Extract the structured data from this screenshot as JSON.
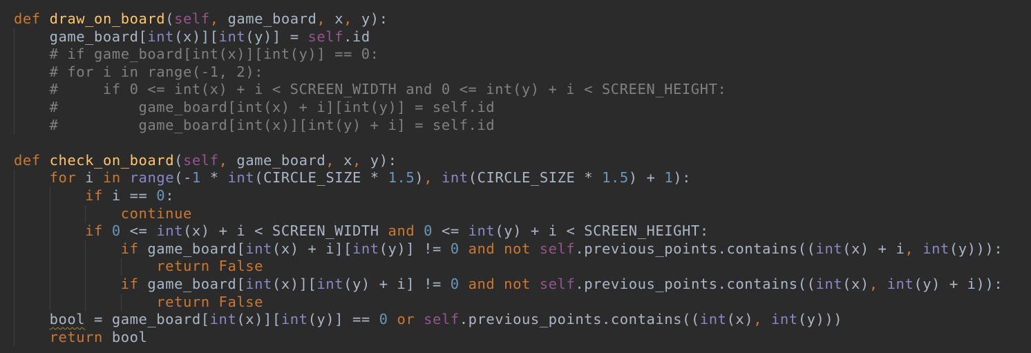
{
  "editor": {
    "lines": [
      [
        {
          "t": "def",
          "c": "kw"
        },
        {
          "t": " ",
          "c": "plain"
        },
        {
          "t": "draw_on_board",
          "c": "fn"
        },
        {
          "t": "(",
          "c": "plain"
        },
        {
          "t": "self",
          "c": "self"
        },
        {
          "t": ",",
          "c": "kw"
        },
        {
          "t": " game_board",
          "c": "plain"
        },
        {
          "t": ",",
          "c": "kw"
        },
        {
          "t": " x",
          "c": "plain"
        },
        {
          "t": ",",
          "c": "kw"
        },
        {
          "t": " y):",
          "c": "plain"
        }
      ],
      [
        {
          "t": "    game_board[",
          "c": "plain"
        },
        {
          "t": "int",
          "c": "builtin"
        },
        {
          "t": "(x)][",
          "c": "plain"
        },
        {
          "t": "int",
          "c": "builtin"
        },
        {
          "t": "(y)] = ",
          "c": "plain"
        },
        {
          "t": "self",
          "c": "self"
        },
        {
          "t": ".id",
          "c": "plain"
        }
      ],
      [
        {
          "t": "    # if game_board[int(x)][int(y)] == 0:",
          "c": "comment"
        }
      ],
      [
        {
          "t": "    # for i in range(-1, 2):",
          "c": "comment"
        }
      ],
      [
        {
          "t": "    #     if 0 <= int(x) + i < SCREEN_WIDTH and 0 <= int(y) + i < SCREEN_HEIGHT:",
          "c": "comment"
        }
      ],
      [
        {
          "t": "    #         game_board[int(x) + i][int(y)] = self.id",
          "c": "comment"
        }
      ],
      [
        {
          "t": "    #         game_board[int(x)][int(y) + i] = self.id",
          "c": "comment"
        }
      ],
      [],
      [
        {
          "t": "def",
          "c": "kw"
        },
        {
          "t": " ",
          "c": "plain"
        },
        {
          "t": "check_on_board",
          "c": "fn"
        },
        {
          "t": "(",
          "c": "plain"
        },
        {
          "t": "self",
          "c": "self"
        },
        {
          "t": ",",
          "c": "kw"
        },
        {
          "t": " game_board",
          "c": "plain"
        },
        {
          "t": ",",
          "c": "kw"
        },
        {
          "t": " x",
          "c": "plain"
        },
        {
          "t": ",",
          "c": "kw"
        },
        {
          "t": " y):",
          "c": "plain"
        }
      ],
      [
        {
          "t": "    ",
          "c": "plain"
        },
        {
          "t": "for",
          "c": "kw"
        },
        {
          "t": " i ",
          "c": "plain"
        },
        {
          "t": "in",
          "c": "kw"
        },
        {
          "t": " ",
          "c": "plain"
        },
        {
          "t": "range",
          "c": "builtin"
        },
        {
          "t": "(-",
          "c": "plain"
        },
        {
          "t": "1",
          "c": "num"
        },
        {
          "t": " * ",
          "c": "plain"
        },
        {
          "t": "int",
          "c": "builtin"
        },
        {
          "t": "(CIRCLE_SIZE * ",
          "c": "plain"
        },
        {
          "t": "1.5",
          "c": "num"
        },
        {
          "t": ")",
          "c": "plain"
        },
        {
          "t": ",",
          "c": "kw"
        },
        {
          "t": " ",
          "c": "plain"
        },
        {
          "t": "int",
          "c": "builtin"
        },
        {
          "t": "(CIRCLE_SIZE * ",
          "c": "plain"
        },
        {
          "t": "1.5",
          "c": "num"
        },
        {
          "t": ") + ",
          "c": "plain"
        },
        {
          "t": "1",
          "c": "num"
        },
        {
          "t": "):",
          "c": "plain"
        }
      ],
      [
        {
          "t": "        ",
          "c": "plain"
        },
        {
          "t": "if",
          "c": "kw"
        },
        {
          "t": " i == ",
          "c": "plain"
        },
        {
          "t": "0",
          "c": "num"
        },
        {
          "t": ":",
          "c": "plain"
        }
      ],
      [
        {
          "t": "            ",
          "c": "plain"
        },
        {
          "t": "continue",
          "c": "kw"
        }
      ],
      [
        {
          "t": "        ",
          "c": "plain"
        },
        {
          "t": "if",
          "c": "kw"
        },
        {
          "t": " ",
          "c": "plain"
        },
        {
          "t": "0",
          "c": "num"
        },
        {
          "t": " <= ",
          "c": "plain"
        },
        {
          "t": "int",
          "c": "builtin"
        },
        {
          "t": "(x) + i < SCREEN_WIDTH ",
          "c": "plain"
        },
        {
          "t": "and",
          "c": "kw"
        },
        {
          "t": " ",
          "c": "plain"
        },
        {
          "t": "0",
          "c": "num"
        },
        {
          "t": " <= ",
          "c": "plain"
        },
        {
          "t": "int",
          "c": "builtin"
        },
        {
          "t": "(y) + i < SCREEN_HEIGHT:",
          "c": "plain"
        }
      ],
      [
        {
          "t": "            ",
          "c": "plain"
        },
        {
          "t": "if",
          "c": "kw"
        },
        {
          "t": " game_board[",
          "c": "plain"
        },
        {
          "t": "int",
          "c": "builtin"
        },
        {
          "t": "(x) + i][",
          "c": "plain"
        },
        {
          "t": "int",
          "c": "builtin"
        },
        {
          "t": "(y)] != ",
          "c": "plain"
        },
        {
          "t": "0",
          "c": "num"
        },
        {
          "t": " ",
          "c": "plain"
        },
        {
          "t": "and not",
          "c": "kw"
        },
        {
          "t": " ",
          "c": "plain"
        },
        {
          "t": "self",
          "c": "self"
        },
        {
          "t": ".previous_points.contains((",
          "c": "plain"
        },
        {
          "t": "int",
          "c": "builtin"
        },
        {
          "t": "(x) + i",
          "c": "plain"
        },
        {
          "t": ",",
          "c": "kw"
        },
        {
          "t": " ",
          "c": "plain"
        },
        {
          "t": "int",
          "c": "builtin"
        },
        {
          "t": "(y))):",
          "c": "plain"
        }
      ],
      [
        {
          "t": "                ",
          "c": "plain"
        },
        {
          "t": "return",
          "c": "kw"
        },
        {
          "t": " ",
          "c": "plain"
        },
        {
          "t": "False",
          "c": "kw"
        }
      ],
      [
        {
          "t": "            ",
          "c": "plain"
        },
        {
          "t": "if",
          "c": "kw"
        },
        {
          "t": " game_board[",
          "c": "plain"
        },
        {
          "t": "int",
          "c": "builtin"
        },
        {
          "t": "(x)][",
          "c": "plain"
        },
        {
          "t": "int",
          "c": "builtin"
        },
        {
          "t": "(y) + i] != ",
          "c": "plain"
        },
        {
          "t": "0",
          "c": "num"
        },
        {
          "t": " ",
          "c": "plain"
        },
        {
          "t": "and not",
          "c": "kw"
        },
        {
          "t": " ",
          "c": "plain"
        },
        {
          "t": "self",
          "c": "self"
        },
        {
          "t": ".previous_points.contains((",
          "c": "plain"
        },
        {
          "t": "int",
          "c": "builtin"
        },
        {
          "t": "(x)",
          "c": "plain"
        },
        {
          "t": ",",
          "c": "kw"
        },
        {
          "t": " ",
          "c": "plain"
        },
        {
          "t": "int",
          "c": "builtin"
        },
        {
          "t": "(y) + i)):",
          "c": "plain"
        }
      ],
      [
        {
          "t": "                ",
          "c": "plain"
        },
        {
          "t": "return",
          "c": "kw"
        },
        {
          "t": " ",
          "c": "plain"
        },
        {
          "t": "False",
          "c": "kw"
        }
      ],
      [
        {
          "t": "    ",
          "c": "plain"
        },
        {
          "t": "bool",
          "c": "warn"
        },
        {
          "t": " = game_board[",
          "c": "plain"
        },
        {
          "t": "int",
          "c": "builtin"
        },
        {
          "t": "(x)][",
          "c": "plain"
        },
        {
          "t": "int",
          "c": "builtin"
        },
        {
          "t": "(y)] == ",
          "c": "plain"
        },
        {
          "t": "0",
          "c": "num"
        },
        {
          "t": " ",
          "c": "plain"
        },
        {
          "t": "or",
          "c": "kw"
        },
        {
          "t": " ",
          "c": "plain"
        },
        {
          "t": "self",
          "c": "self"
        },
        {
          "t": ".previous_points.contains((",
          "c": "plain"
        },
        {
          "t": "int",
          "c": "builtin"
        },
        {
          "t": "(x)",
          "c": "plain"
        },
        {
          "t": ",",
          "c": "kw"
        },
        {
          "t": " ",
          "c": "plain"
        },
        {
          "t": "int",
          "c": "builtin"
        },
        {
          "t": "(y)))",
          "c": "plain"
        }
      ],
      [
        {
          "t": "    ",
          "c": "plain"
        },
        {
          "t": "return",
          "c": "kw"
        },
        {
          "t": " bool",
          "c": "plain"
        }
      ]
    ]
  },
  "colors": {
    "background": "#2b2b2b",
    "keyword": "#cc7832",
    "function": "#ffc66d",
    "self": "#94558d",
    "builtin": "#8888c6",
    "number": "#6897bb",
    "comment": "#808080",
    "text": "#a9b7c6"
  }
}
